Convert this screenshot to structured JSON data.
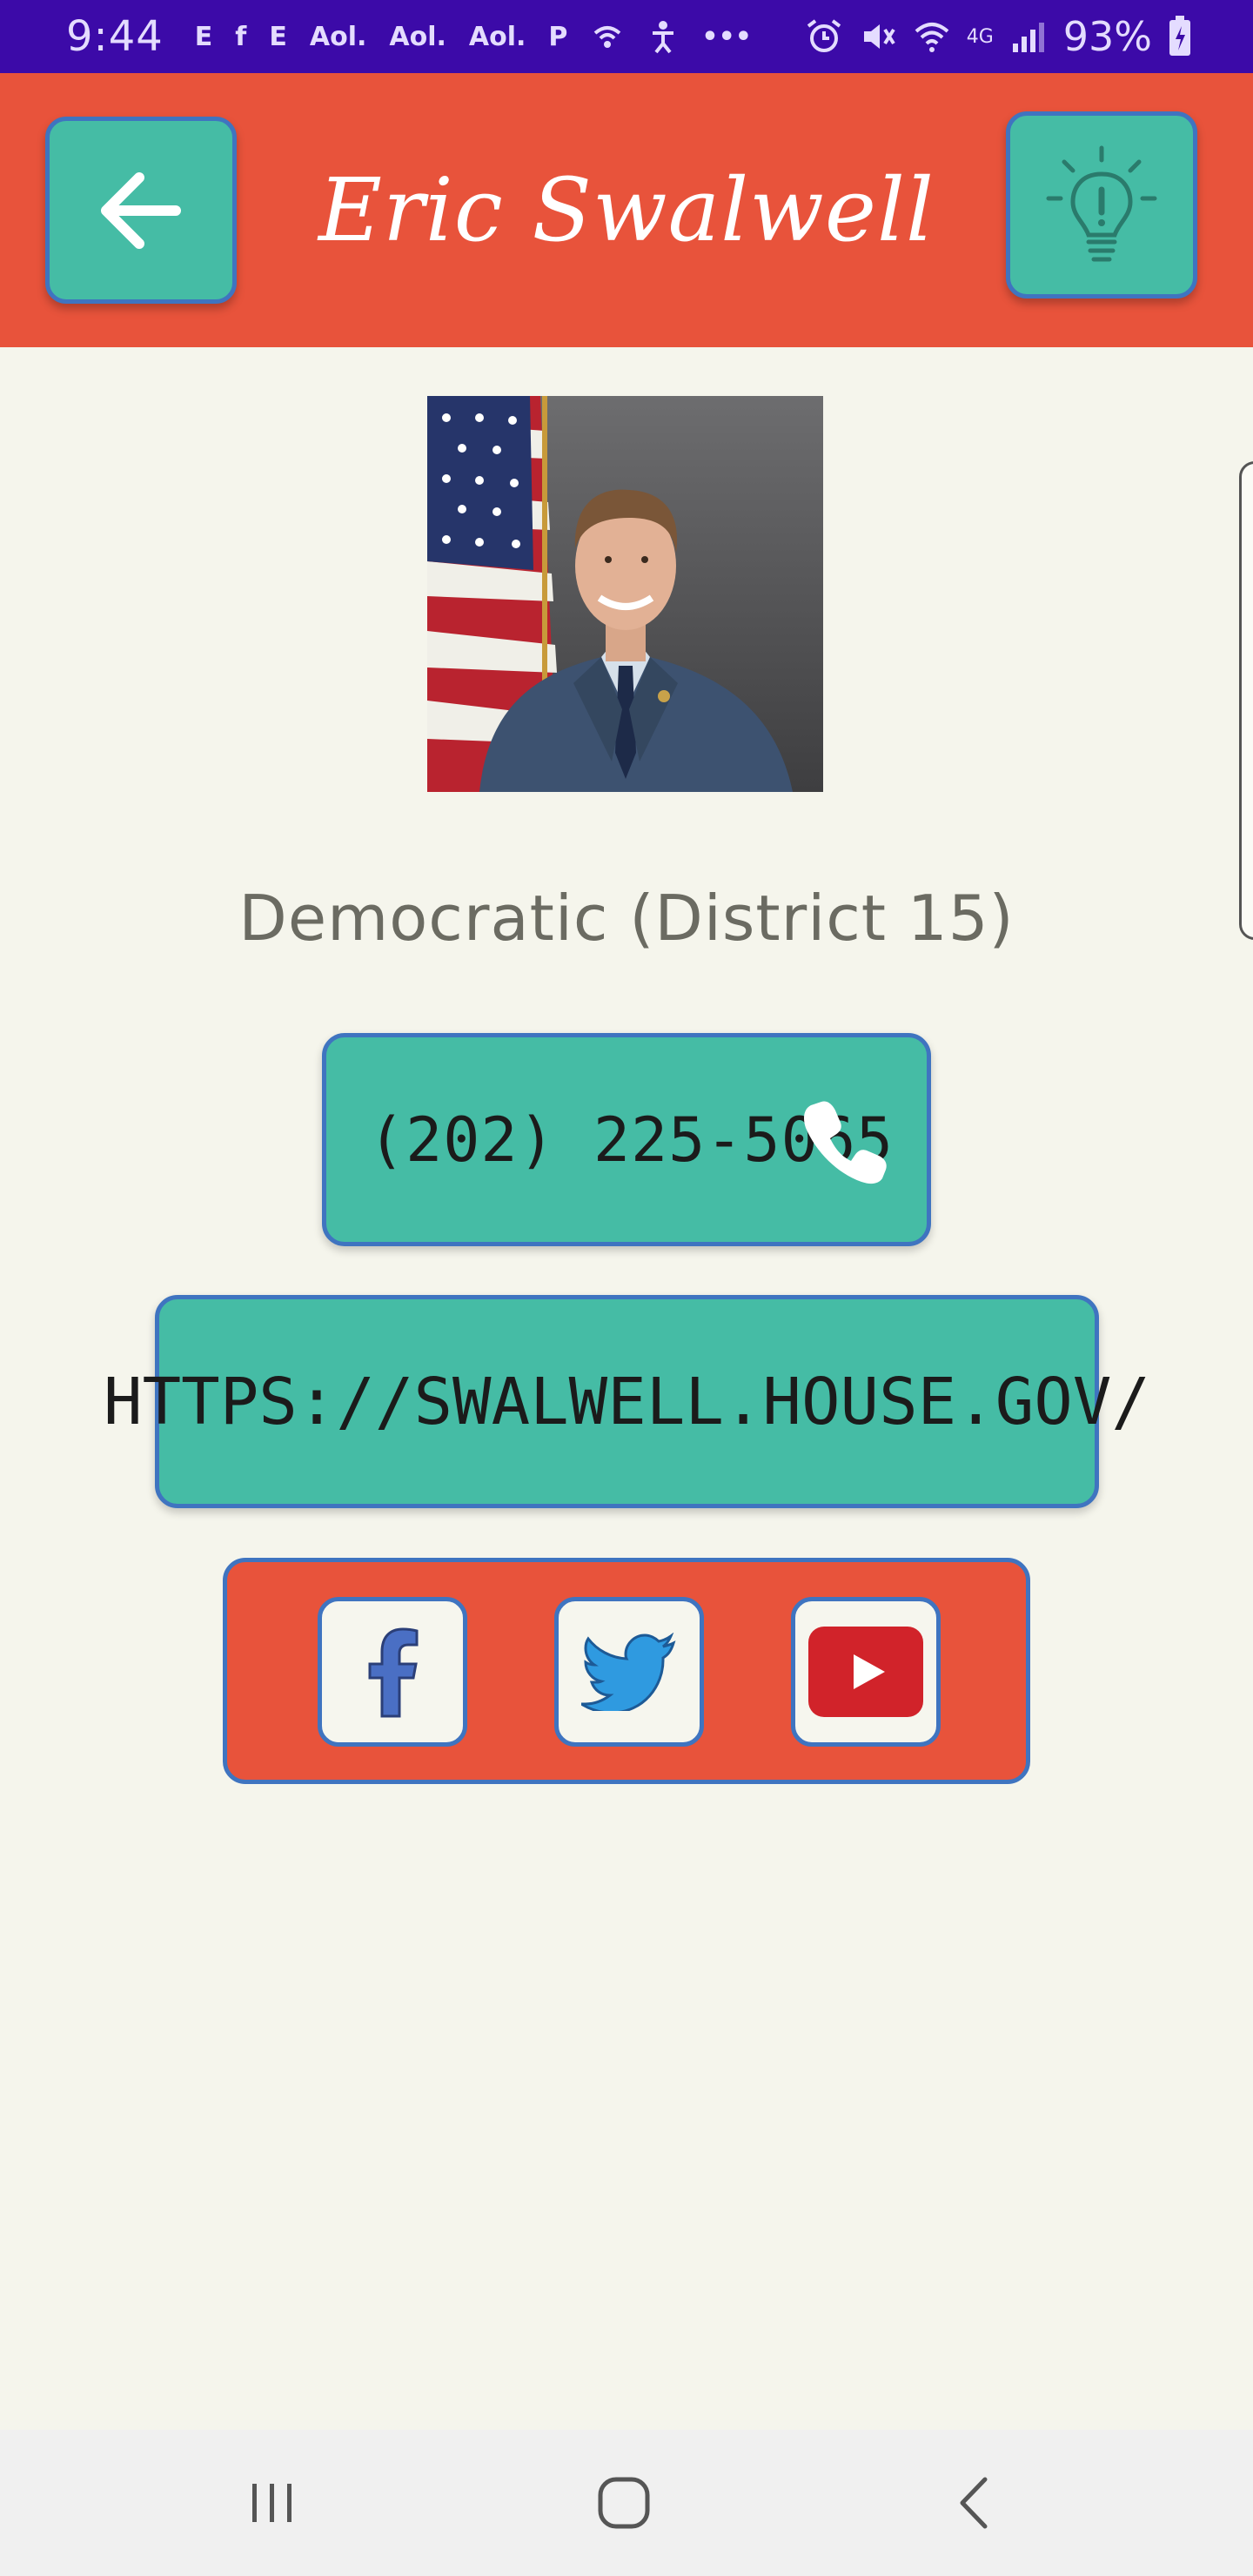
{
  "status_bar": {
    "time": "9:44",
    "notification_icons": [
      "E",
      "f",
      "E",
      "Aol.",
      "Aol.",
      "Aol.",
      "P"
    ],
    "more": "•••",
    "network": "4G",
    "battery": "93%"
  },
  "header": {
    "title": "Eric Swalwell",
    "back_icon": "arrow-left-icon",
    "tip_icon": "lightbulb-icon"
  },
  "profile": {
    "party_district": "Democratic (District 15)",
    "phone": "(202) 225-5065",
    "website": "HTTPS://SWALWELL.HOUSE.GOV/"
  },
  "social": {
    "items": [
      "facebook-icon",
      "twitter-icon",
      "youtube-icon"
    ]
  },
  "colors": {
    "status_bar": "#3c0aa8",
    "header": "#e8533b",
    "accent": "#45bca5",
    "border": "#3f74c0",
    "background": "#f5f5ec"
  }
}
